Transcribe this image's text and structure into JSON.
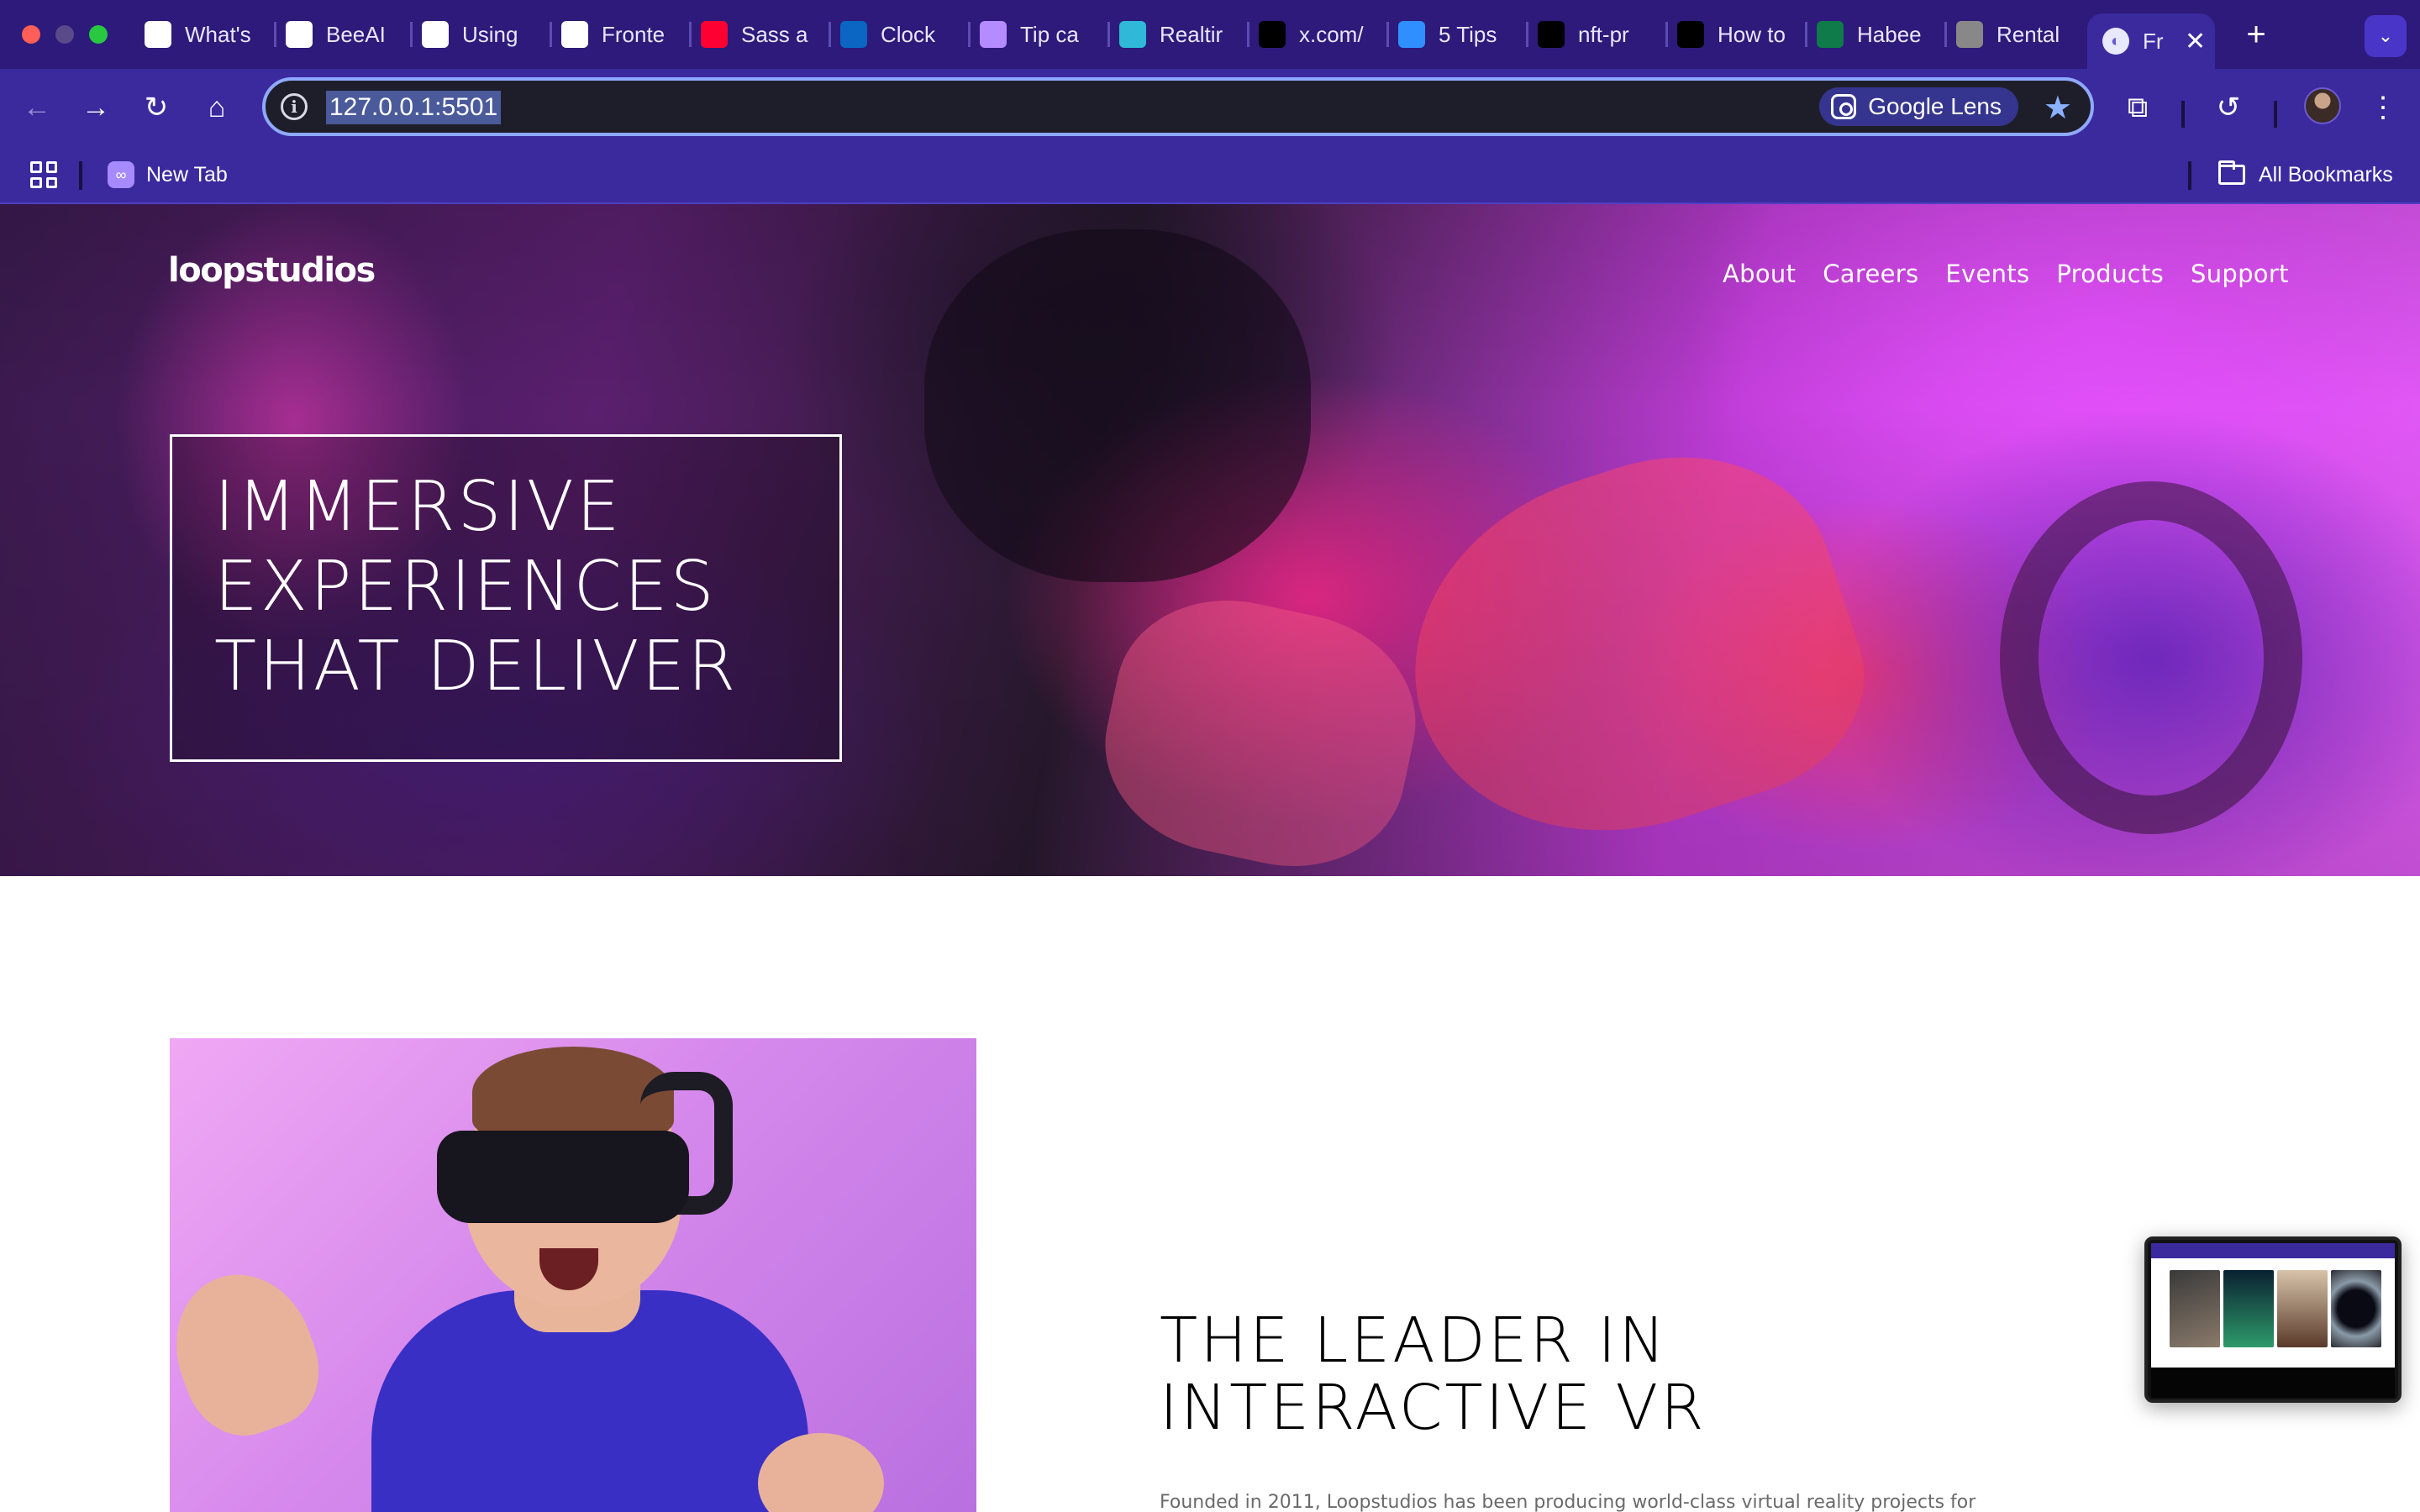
{
  "browser": {
    "tabs": [
      {
        "label": "What's",
        "icon": "chrome-icon",
        "color": "#ffffff"
      },
      {
        "label": "BeeAI",
        "icon": "github-icon",
        "color": "#ffffff"
      },
      {
        "label": "Using",
        "icon": "cz-icon",
        "color": "#ffffff"
      },
      {
        "label": "Fronte",
        "icon": "frontend-mentor-icon",
        "color": "#ffffff"
      },
      {
        "label": "Sass a",
        "icon": "youtube-icon",
        "color": "#ff0033"
      },
      {
        "label": "Clock",
        "icon": "linkedin-icon",
        "color": "#0a66c2"
      },
      {
        "label": "Tip ca",
        "icon": "brain-icon",
        "color": "#b58cff"
      },
      {
        "label": "Realtir",
        "icon": "realtor-icon",
        "color": "#2fb8d8"
      },
      {
        "label": "x.com/",
        "icon": "x-icon",
        "color": "#000000"
      },
      {
        "label": "5 Tips",
        "icon": "spinner-icon",
        "color": "#2f8fff"
      },
      {
        "label": "nft-pr",
        "icon": "vercel-icon",
        "color": "#000000"
      },
      {
        "label": "How to",
        "icon": "medium-icon",
        "color": "#000000"
      },
      {
        "label": "Habee",
        "icon": "habee-icon",
        "color": "#0f7a4a"
      },
      {
        "label": "Rental",
        "icon": "globe-icon",
        "color": "#888888"
      }
    ],
    "active_tab": {
      "label": "Fr",
      "icon": "live-server-icon"
    },
    "address": "127.0.0.1:5501",
    "google_lens_label": "Google Lens",
    "bookmarks": {
      "new_tab_label": "New Tab",
      "all_bookmarks_label": "All Bookmarks"
    }
  },
  "site": {
    "logo": "loopstudios",
    "nav": [
      "About",
      "Careers",
      "Events",
      "Products",
      "Support"
    ],
    "hero_title_lines": [
      "IMMERSIVE",
      "EXPERIENCES",
      "THAT DELIVER"
    ],
    "section_title_lines": [
      "THE LEADER IN",
      "INTERACTIVE VR"
    ],
    "section_text": "Founded in 2011, Loopstudios has been producing world-class virtual reality projects for"
  }
}
